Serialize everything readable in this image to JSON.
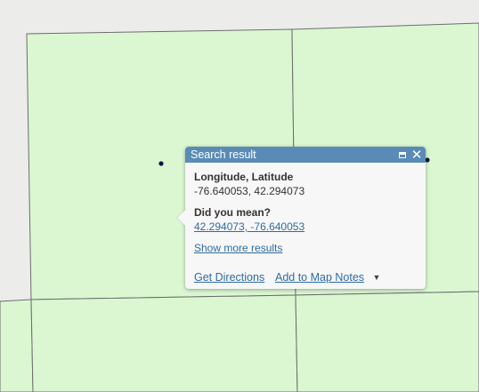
{
  "colors": {
    "background": "#ececeb",
    "parcel_fill": "#daf7d1",
    "parcel_border": "#6d6d6d",
    "header": "#5a8bb6",
    "link": "#2d6ca2",
    "marker": "#0b1747"
  },
  "popup": {
    "title": "Search result",
    "maximize_icon": "maximize-icon",
    "close_icon": "close-icon",
    "close_glyph": "✕",
    "label": "Longitude, Latitude",
    "coordinates": "-76.640053, 42.294073",
    "did_you_mean_label": "Did you mean?",
    "suggestion": "42.294073, -76.640053",
    "show_more": "Show more results",
    "get_directions": "Get Directions",
    "add_to_notes": "Add to Map Notes",
    "dropdown_glyph": "▼"
  }
}
